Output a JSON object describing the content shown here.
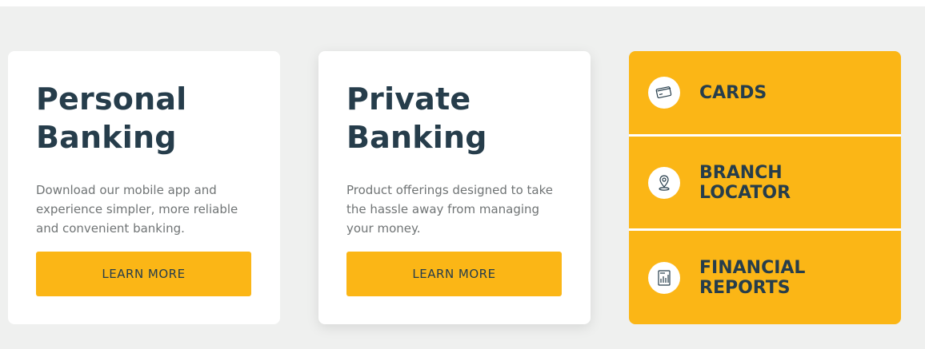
{
  "cards": [
    {
      "title": "Personal\nBanking",
      "description": "Download our mobile app and experience simpler, more reliable and convenient banking.",
      "button_label": "LEARN MORE"
    },
    {
      "title": "Private\nBanking",
      "description": "Product offerings designed to take the hassle away from managing your money.",
      "button_label": "LEARN MORE"
    }
  ],
  "quick_links": [
    {
      "label": "CARDS",
      "icon": "credit-card-icon"
    },
    {
      "label": "BRANCH\nLOCATOR",
      "icon": "location-pin-icon"
    },
    {
      "label": "FINANCIAL\nREPORTS",
      "icon": "report-chart-icon"
    }
  ],
  "colors": {
    "accent": "#fbb616",
    "heading": "#263d4b",
    "body_text": "#707475",
    "section_bg": "#eff0ef"
  }
}
